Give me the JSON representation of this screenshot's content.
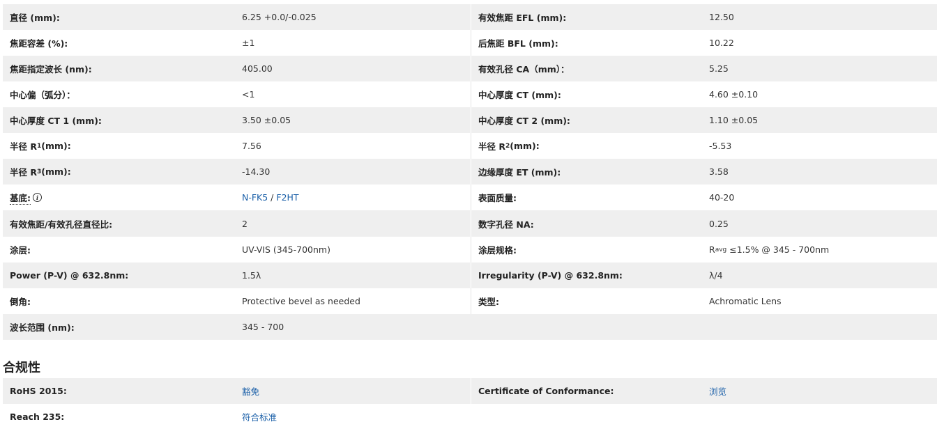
{
  "specs": [
    {
      "l1": "直径 (mm):",
      "v1": "6.25 +0.0/-0.025",
      "l2": "有效焦距 EFL (mm):",
      "v2": "12.50"
    },
    {
      "l1": "焦距容差 (%):",
      "v1": "±1",
      "l2": "后焦距 BFL (mm):",
      "v2": "10.22"
    },
    {
      "l1": "焦距指定波长 (nm):",
      "v1": "405.00",
      "l2": "有效孔径 CA（mm）：",
      "v2": "5.25"
    },
    {
      "l1": "中心偏（弧分）：",
      "v1": "<1",
      "l2": "中心厚度 CT (mm):",
      "v2": "4.60 ±0.10"
    },
    {
      "l1": "中心厚度 CT 1 (mm):",
      "v1": "3.50 ±0.05",
      "l2": "中心厚度 CT 2 (mm):",
      "v2": "1.10 ±0.05"
    },
    {
      "l1_pre": "半径 R",
      "l1_sub": "1",
      "l1_post": " (mm):",
      "v1": "7.56",
      "l2_pre": "半径 R",
      "l2_sub": "2",
      "l2_post": " (mm):",
      "v2": "-5.53"
    },
    {
      "l1_pre": "半径 R",
      "l1_sub": "3",
      "l1_post": " (mm):",
      "v1": "-14.30",
      "l2": "边缘厚度 ET (mm):",
      "v2": "3.58"
    },
    {
      "l1": "基底:",
      "v1_link1": "N-FK5",
      "v1_sep": " / ",
      "v1_link2": "F2HT",
      "l2": "表面质量:",
      "v2": "40-20"
    },
    {
      "l1": "有效焦距/有效孔径直径比:",
      "v1": "2",
      "l2": "数字孔径 NA:",
      "v2": "0.25"
    },
    {
      "l1": "涂层:",
      "v1": "UV-VIS (345-700nm)",
      "l2": "涂层规格:",
      "v2_pre": "R",
      "v2_sub": "avg",
      "v2_post": " ≤1.5% @ 345 - 700nm"
    },
    {
      "l1": "Power (P-V) @ 632.8nm:",
      "v1": "1.5λ",
      "l2": "Irregularity (P-V) @ 632.8nm:",
      "v2": "λ/4"
    },
    {
      "l1": "倒角:",
      "v1": "Protective bevel as needed",
      "l2": "类型:",
      "v2": "Achromatic Lens"
    },
    {
      "l1": "波长范围 (nm):",
      "v1": "345 - 700",
      "l2": "",
      "v2": ""
    }
  ],
  "compliance": {
    "title": "合规性",
    "rows": [
      {
        "l1": "RoHS 2015:",
        "v1": "豁免",
        "l2": "Certificate of Conformance:",
        "v2": "浏览"
      },
      {
        "l1": "Reach 235:",
        "v1": "符合标准",
        "l2": "",
        "v2": ""
      }
    ]
  },
  "info_icon_glyph": "i"
}
